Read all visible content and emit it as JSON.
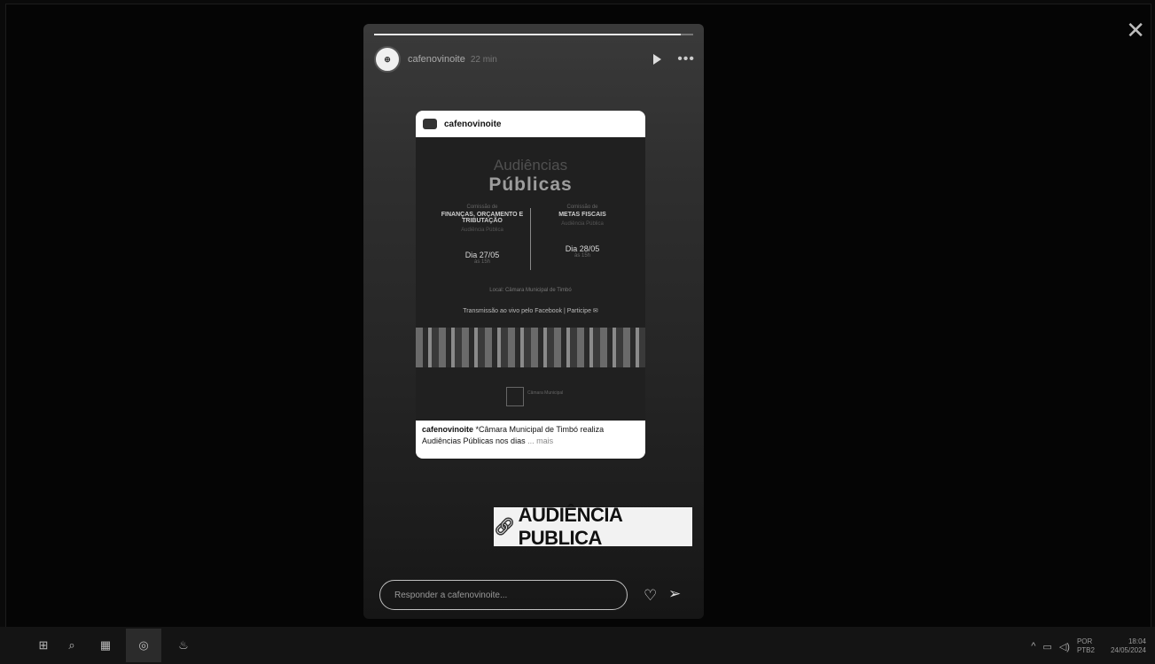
{
  "viewer": {
    "close_icon": "close-icon"
  },
  "story": {
    "username": "cafenovinoite",
    "time": "22 min",
    "progress_percent": 96,
    "post": {
      "username": "cafenovinoite",
      "poster": {
        "title_line1": "Audiências",
        "title_line2": "Públicas",
        "left": {
          "small": "Comissão de",
          "name": "FINANÇAS, ORÇAMENTO E TRIBUTAÇÃO",
          "sub": "Audiência Pública",
          "date": "Dia 27/05",
          "time": "às 15h"
        },
        "right": {
          "small": "Comissão de",
          "name": "METAS FISCAIS",
          "sub": "Audiência Pública",
          "date": "Dia 28/05",
          "time": "às 15h"
        },
        "local": "Local: Câmara Municipal de Timbó",
        "transmission": "Transmissão ao vivo pelo Facebook  |  Participe ✉",
        "logo_text": "Câmara Municipal"
      },
      "caption_user": "cafenovinoite",
      "caption_text": " *Câmara Municipal de Timbó realiza Audiências Públicas nos dias",
      "caption_more": "... mais"
    },
    "sticker": {
      "icon": "link-icon",
      "label": "AUDIÊNCIA PUBLICA"
    },
    "reply_placeholder": "Responder a cafenovinoite..."
  },
  "taskbar": {
    "lang_line1": "POR",
    "lang_line2": "PTB2",
    "time": "18:04",
    "date": "24/05/2024"
  }
}
